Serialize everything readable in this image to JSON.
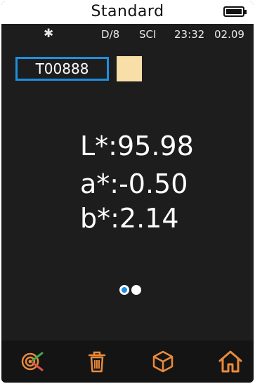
{
  "header": {
    "title": "Standard"
  },
  "status": {
    "bluetooth_glyph": "✱",
    "mode": "D/8",
    "specular": "SCI",
    "time": "23:32",
    "date": "02.09"
  },
  "sample": {
    "id": "T00888",
    "swatch_color": "#f8dfa8"
  },
  "readings": {
    "L": "L*:95.98",
    "a": "a*:-0.50",
    "b": "b*:2.14"
  },
  "pager": {
    "pages": 2,
    "current": 1
  },
  "nav": {
    "items": [
      {
        "icon": "target-measure-icon"
      },
      {
        "icon": "trash-icon"
      },
      {
        "icon": "cube-icon"
      },
      {
        "icon": "home-icon"
      }
    ],
    "icon_color": "#e98a3c"
  },
  "colors": {
    "accent": "#1d8fe0",
    "background": "#1d1d1d"
  }
}
